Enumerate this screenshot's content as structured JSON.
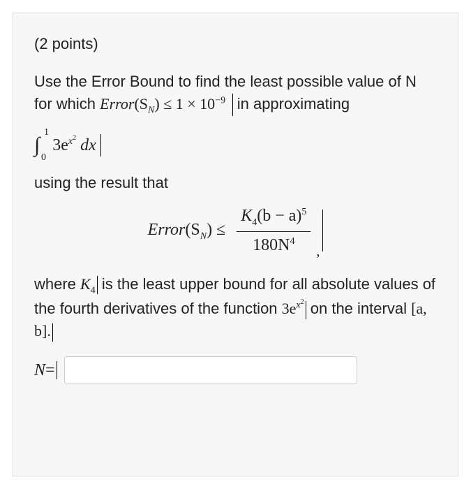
{
  "points_label": "(2 points)",
  "intro": {
    "part1": "Use the Error Bound to find the least possible value of N for which ",
    "error_sym": "Error",
    "sn_open": "(S",
    "sn_sub": "N",
    "sn_close": ") ≤ 1 × 10",
    "exp_neg9": "−9",
    "part2": " in approximating"
  },
  "integral": {
    "sign": "∫",
    "lower": "0",
    "upper": "1",
    "coef": "3e",
    "expx": "x",
    "exp2": "2",
    "dx": " dx"
  },
  "using_text": "using the result that",
  "formula": {
    "lhs_error": "Error",
    "lhs_open": "(S",
    "lhs_sub": "N",
    "lhs_close": ") ≤ ",
    "num_k": "K",
    "num_sub4": "4",
    "num_paren": "(b − a)",
    "num_sup5": "5",
    "den_180": "180N",
    "den_sup4": "4"
  },
  "where": {
    "part1": "where ",
    "k4_k": "K",
    "k4_sub": "4",
    "part2": " is the least upper bound for all absolute values of the fourth derivatives of the function ",
    "fn_coef": "3e",
    "fn_expx": "x",
    "fn_exp2": "2",
    "part3": " on the interval ",
    "interval": "[a, b].",
    "period": ""
  },
  "answer": {
    "label_n": "N",
    "equals": " ="
  },
  "input": {
    "value": "",
    "placeholder": ""
  }
}
